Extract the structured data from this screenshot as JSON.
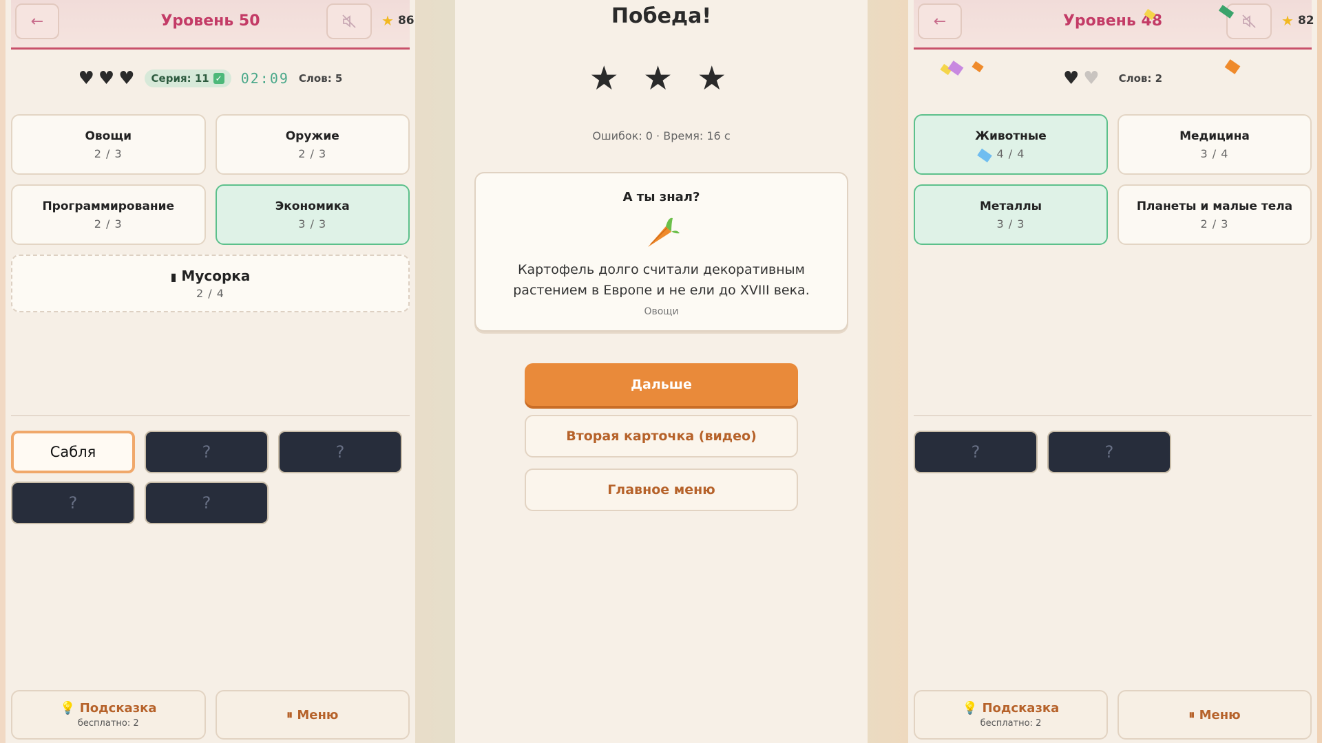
{
  "left": {
    "back_label": "←",
    "level_title": "Уровень 50",
    "stars": "86",
    "streak_label": "Серия: 11",
    "timer": "02:09",
    "words_count": "Слов: 5",
    "categories": [
      {
        "name": "Овощи",
        "count": "2 / 3"
      },
      {
        "name": "Оружие",
        "count": "2 / 3"
      },
      {
        "name": "Программирование",
        "count": "2 / 3"
      },
      {
        "name": "Экономика",
        "count": "3 / 3"
      }
    ],
    "trash": {
      "name": "Мусорка",
      "count": "2 / 4"
    },
    "words": [
      "Сабля",
      "?",
      "?",
      "?",
      "?"
    ],
    "hint": {
      "label": "Подсказка",
      "sub": "бесплатно: 2"
    },
    "menu_label": "Меню"
  },
  "middle": {
    "title": "Победа!",
    "stars": "★ ★ ★",
    "stats": "Ошибок: 0 · Время: 16 с",
    "fact_title": "А ты знал?",
    "fact_text": "Картофель долго считали декоративным растением в Европе и не ели до XVIII века.",
    "fact_category": "Овощи",
    "next_button": "Дальше",
    "second_card_button": "Вторая карточка (видео)",
    "main_menu_button": "Главное меню"
  },
  "right": {
    "back_label": "←",
    "level_title": "Уровень 48",
    "stars": "82",
    "words_count": "Слов: 2",
    "categories": [
      {
        "name": "Животные",
        "count": "4 / 4"
      },
      {
        "name": "Медицина",
        "count": "3 / 4"
      },
      {
        "name": "Металлы",
        "count": "3 / 3"
      },
      {
        "name": "Планеты и малые тела",
        "count": "2 / 3"
      }
    ],
    "words": [
      "?",
      "?"
    ],
    "hint": {
      "label": "Подсказка",
      "sub": "бесплатно: 2"
    },
    "menu_label": "Меню"
  },
  "colors": {
    "accent": "#c33b66",
    "done_bg": "#dff2e7",
    "done_border": "#5cc08b",
    "primary_button": "#e98a3a",
    "hidden_word": "#272d3b"
  },
  "icons": {
    "back": "arrow-left-icon",
    "mute": "sound-muted-icon",
    "star": "star-icon",
    "heart": "heart-icon",
    "check": "check-icon",
    "trash": "trash-icon",
    "hint": "lightbulb-icon",
    "pause": "pause-icon",
    "carrot": "carrot-icon"
  }
}
